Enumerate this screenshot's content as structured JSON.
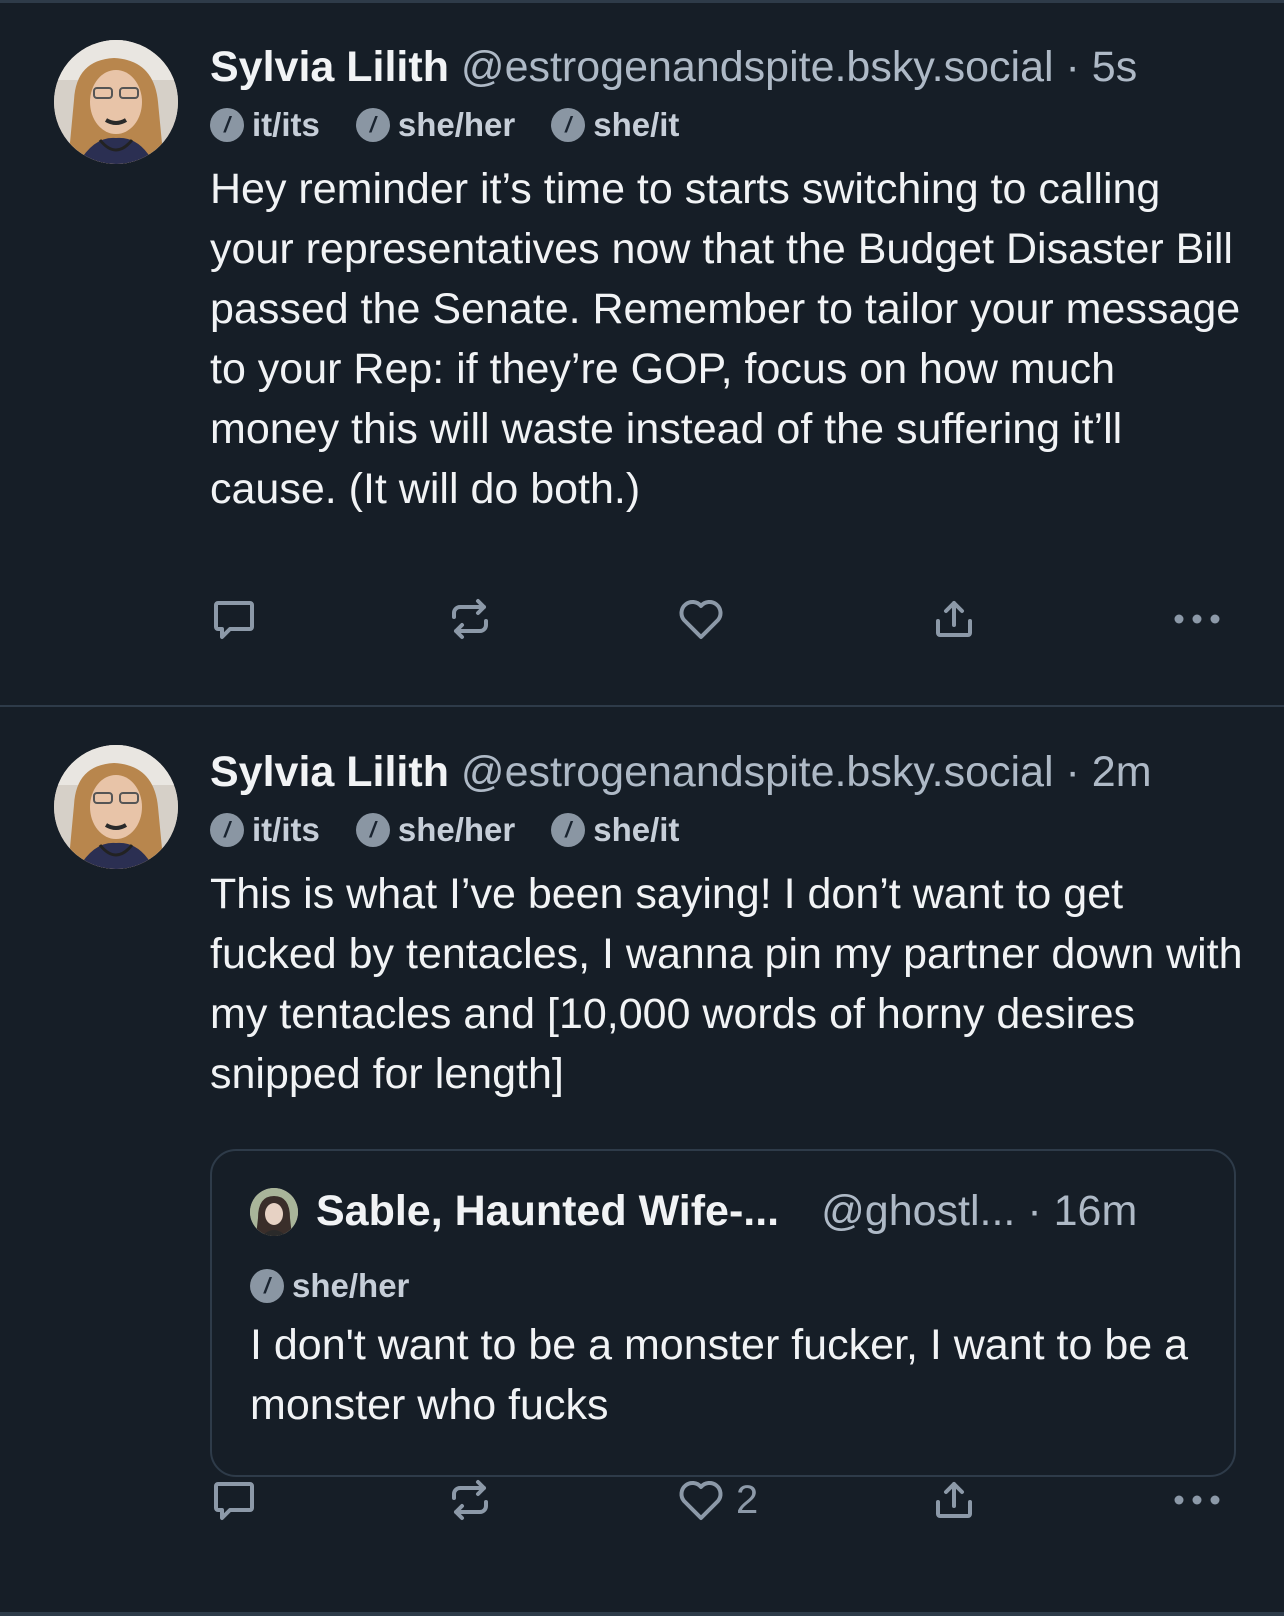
{
  "posts": [
    {
      "author": {
        "name": "Sylvia Lilith",
        "handle": "@estrogenandspite.bsky.social",
        "time": "5s"
      },
      "separator": "·",
      "pronouns": [
        "it/its",
        "she/her",
        "she/it"
      ],
      "text": "Hey reminder it’s time to starts switching to calling your representatives now that the Budget Disaster Bill passed the Senate. Remember to tailor your message to your Rep: if they’re GOP, focus on how much money this will waste instead of the suffering it’ll cause. (It will do both.)",
      "like_count": ""
    },
    {
      "author": {
        "name": "Sylvia Lilith",
        "handle": "@estrogenandspite.bsky.social",
        "time": "2m"
      },
      "separator": "·",
      "pronouns": [
        "it/its",
        "she/her",
        "she/it"
      ],
      "text": "This is what I’ve been saying! I don’t want to get fucked by tentacles, I wanna pin my partner down with my tentacles and [10,000 words of horny desires snipped for length]",
      "quote": {
        "name": "Sable, Haunted Wife-...",
        "handle": "@ghostl...",
        "separator": "·",
        "time": "16m",
        "pronoun": "she/her",
        "text": "I don't want to be a monster fucker, I want to be a monster who fucks"
      },
      "like_count": "2"
    }
  ],
  "icons": {
    "pronoun": "pronoun-info-icon",
    "reply": "reply-icon",
    "repost": "repost-icon",
    "like": "heart-icon",
    "share": "share-icon",
    "more": "more-icon"
  },
  "colors": {
    "background": "#161e27",
    "divider": "#2e3b49",
    "text": "#f1f3f5",
    "muted": "#aeb9c6",
    "icon": "#8c99a8"
  }
}
